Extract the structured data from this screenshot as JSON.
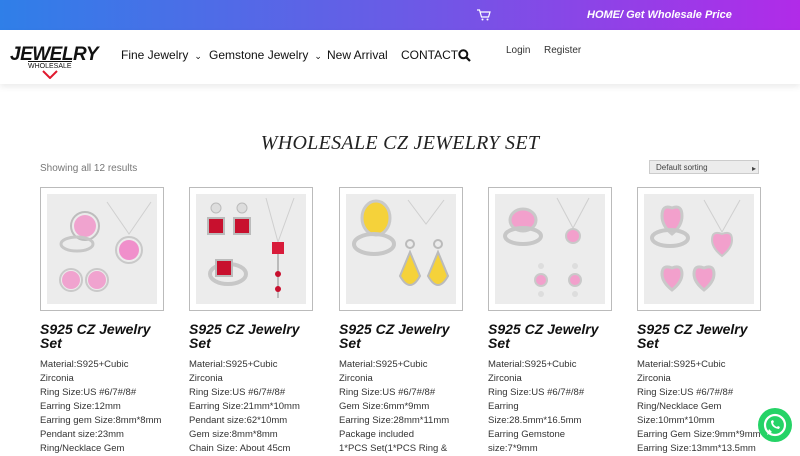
{
  "topbar": {
    "promo": "HOME/ Get Wholesale Price",
    "cart_icon": "cart-icon"
  },
  "logo": {
    "word": "JEWELRY",
    "sub": "WHOLESALE"
  },
  "nav": [
    {
      "label": "Fine Jewelry",
      "caret": "⌄"
    },
    {
      "label": "Gemstone Jewelry",
      "caret": "⌄"
    },
    {
      "label": "New Arrival",
      "caret": ""
    },
    {
      "label": "CONTACT",
      "caret": ""
    }
  ],
  "auth": {
    "login": "Login",
    "register": "Register"
  },
  "page": {
    "title": "WHOLESALE CZ JEWELRY SET",
    "results": "Showing all 12 results",
    "sort": "Default sorting"
  },
  "products": [
    {
      "title": "S925 CZ Jewelry Set",
      "lines": [
        "Material:S925+Cubic",
        "Zirconia",
        "Ring Size:US #6/7#/8#",
        "Earring Size:12mm",
        "Earring gem Size:8mm*8mm",
        "Pendant size:23mm",
        "Ring/Necklace Gem"
      ]
    },
    {
      "title": "S925 CZ Jewelry Set",
      "lines": [
        "Material:S925+Cubic",
        "Zirconia",
        "Ring Size:US #6/7#/8#",
        "Earring Size:21mm*10mm",
        "Pendant size:62*10mm",
        "Gem size:8mm*8mm",
        "Chain Size: About 45cm"
      ]
    },
    {
      "title": "S925 CZ Jewelry Set",
      "lines": [
        "Material:S925+Cubic",
        "Zirconia",
        "Ring Size:US #6/7#/8#",
        "Gem Size:6mm*9mm",
        "Earring Size:28mm*11mm",
        "Package included",
        "1*PCS Set(1*PCS Ring &"
      ]
    },
    {
      "title": "S925 CZ Jewelry Set",
      "lines": [
        "Material:S925+Cubic",
        "Zirconia",
        "Ring Size:US #6/7#/8#",
        "Earring",
        "Size:28.5mm*16.5mm",
        "Earring Gemstone",
        "size:7*9mm"
      ]
    },
    {
      "title": "S925 CZ Jewelry Set",
      "lines": [
        "Material:S925+Cubic",
        "Zirconia",
        "Ring Size:US #6/7#/8#",
        "Ring/Necklace Gem",
        "Size:10mm*10mm",
        "Earring Gem Size:9mm*9mm",
        "Earring Size:13mm*13.5mm"
      ]
    }
  ]
}
